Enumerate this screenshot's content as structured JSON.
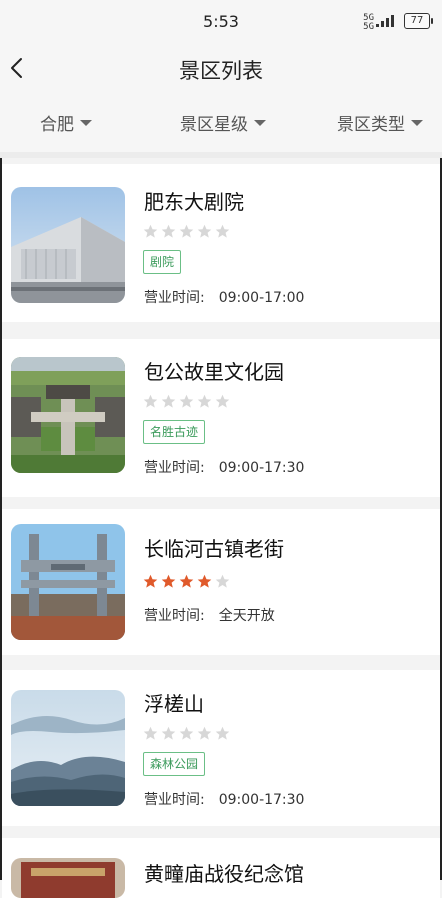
{
  "status": {
    "time": "5:53",
    "battery": "77",
    "net_top": "5G",
    "net_bottom": "5G"
  },
  "nav": {
    "title": "景区列表"
  },
  "filters": [
    {
      "label": "合肥"
    },
    {
      "label": "景区星级"
    },
    {
      "label": "景区类型"
    }
  ],
  "hours_label": "营业时间:",
  "spots": [
    {
      "name": "肥东大剧院",
      "rating": 0,
      "tag": "剧院",
      "hours": "09:00-17:00"
    },
    {
      "name": "包公故里文化园",
      "rating": 0,
      "tag": "名胜古迹",
      "hours": "09:00-17:30"
    },
    {
      "name": "长临河古镇老街",
      "rating": 4,
      "tag": "",
      "hours": "全天开放"
    },
    {
      "name": "浮槎山",
      "rating": 0,
      "tag": "森林公园",
      "hours": "09:00-17:30"
    },
    {
      "name": "黄疃庙战役纪念馆",
      "rating": 0,
      "tag": "",
      "hours": ""
    }
  ],
  "colors": {
    "star_on": "#e05a2b",
    "star_off": "#d7d7d7",
    "tag": "#3a9a5a"
  }
}
